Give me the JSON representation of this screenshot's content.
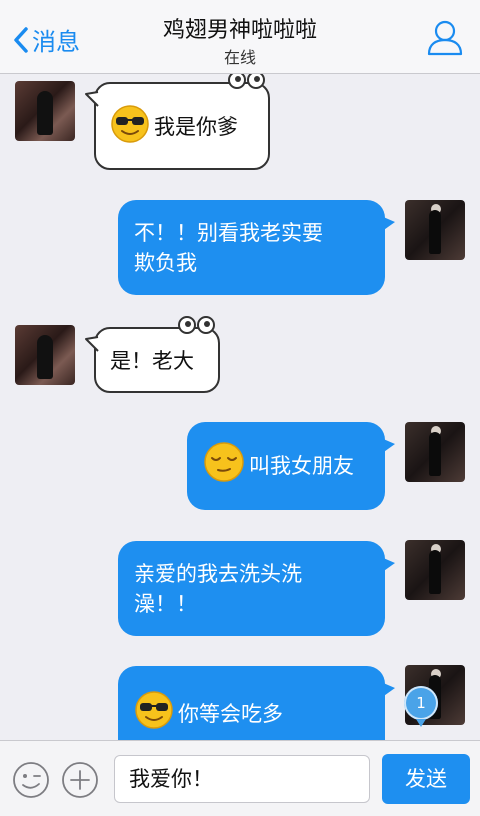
{
  "header": {
    "back_label": "消息",
    "title": "鸡翅男神啦啦啦",
    "subtitle": "在线"
  },
  "messages": [
    {
      "side": "left",
      "emoji": "sunglasses-emoji",
      "text": "我是你爹"
    },
    {
      "side": "right",
      "lines": [
        "不！！别看我老实要",
        "欺负我"
      ]
    },
    {
      "side": "left",
      "text": "是！老大"
    },
    {
      "side": "right",
      "emoji": "relieved-emoji",
      "text": "叫我女朋友"
    },
    {
      "side": "right",
      "lines": [
        "亲爱的我去洗头洗",
        "澡！！"
      ]
    },
    {
      "side": "right",
      "emoji": "sunglasses-emoji",
      "text": "你等会吃多"
    }
  ],
  "unread_badge": "1",
  "input": {
    "value": "我爱你！",
    "send_label": "发送"
  },
  "colors": {
    "accent": "#1e8ff0",
    "background": "#eeeef3"
  }
}
